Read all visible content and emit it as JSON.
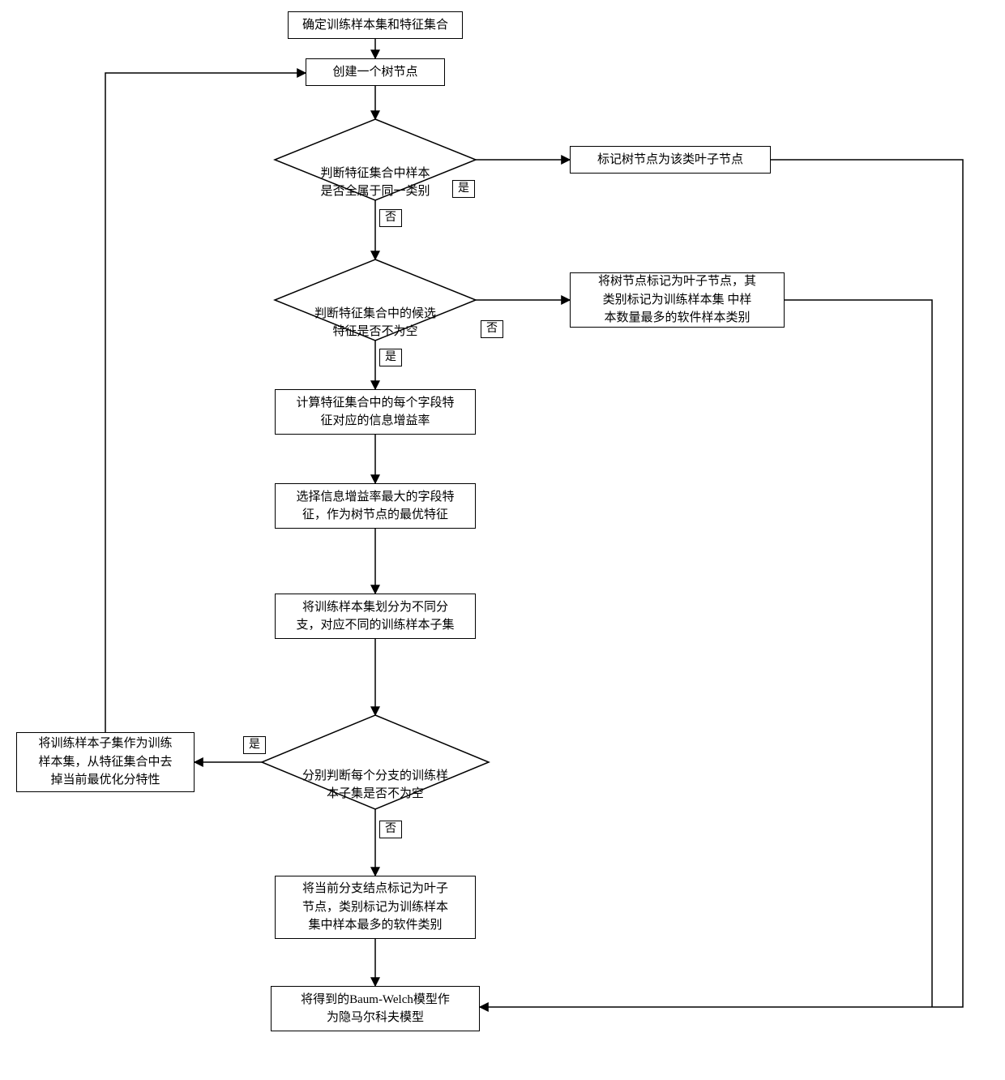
{
  "chart_data": {
    "type": "flowchart",
    "nodes": [
      {
        "id": "n1",
        "shape": "rect",
        "text": "确定训练样本集和特征集合"
      },
      {
        "id": "n2",
        "shape": "rect",
        "text": "创建一个树节点"
      },
      {
        "id": "d1",
        "shape": "diamond",
        "text": "判断特征集合中样本是否全属于同一类别"
      },
      {
        "id": "r1",
        "shape": "rect",
        "text": "标记树节点为该类叶子节点"
      },
      {
        "id": "d2",
        "shape": "diamond",
        "text": "判断特征集合中的候选特征是否不为空"
      },
      {
        "id": "r2",
        "shape": "rect",
        "text": "将树节点标记为叶子节点，其类别标记为训练样本集 中样本数量最多的软件样本类别"
      },
      {
        "id": "n3",
        "shape": "rect",
        "text": "计算特征集合中的每个字段特征对应的信息增益率"
      },
      {
        "id": "n4",
        "shape": "rect",
        "text": "选择信息增益率最大的字段特征，作为树节点的最优特征"
      },
      {
        "id": "n5",
        "shape": "rect",
        "text": "将训练样本集划分为不同分支，对应不同的训练样本子集"
      },
      {
        "id": "d3",
        "shape": "diamond",
        "text": "分别判断每个分支的训练样本子集是否不为空"
      },
      {
        "id": "l1",
        "shape": "rect",
        "text": "将训练样本子集作为训练样本集，从特征集合中去掉当前最优化分特性"
      },
      {
        "id": "n6",
        "shape": "rect",
        "text": "将当前分支结点标记为叶子节点，类别标记为训练样本集中样本最多的软件类别"
      },
      {
        "id": "n7",
        "shape": "rect",
        "text": "将得到的Baum-Welch模型作为隐马尔科夫模型"
      }
    ],
    "edges": [
      {
        "from": "n1",
        "to": "n2"
      },
      {
        "from": "n2",
        "to": "d1"
      },
      {
        "from": "d1",
        "to": "r1",
        "label": "是"
      },
      {
        "from": "d1",
        "to": "d2",
        "label": "否"
      },
      {
        "from": "d2",
        "to": "r2",
        "label": "否"
      },
      {
        "from": "d2",
        "to": "n3",
        "label": "是"
      },
      {
        "from": "n3",
        "to": "n4"
      },
      {
        "from": "n4",
        "to": "n5"
      },
      {
        "from": "n5",
        "to": "d3"
      },
      {
        "from": "d3",
        "to": "l1",
        "label": "是"
      },
      {
        "from": "d3",
        "to": "n6",
        "label": "否"
      },
      {
        "from": "l1",
        "to": "n2"
      },
      {
        "from": "n6",
        "to": "n7"
      },
      {
        "from": "r1",
        "to": "n7"
      },
      {
        "from": "r2",
        "to": "n7"
      }
    ],
    "edge_labels": {
      "yes": "是",
      "no": "否"
    }
  },
  "nodes": {
    "n1": "确定训练样本集和特征集合",
    "n2": "创建一个树节点",
    "d1": "判断特征集合中样本\n是否全属于同一类别",
    "r1": "标记树节点为该类叶子节点",
    "d2": "判断特征集合中的候选\n特征是否不为空",
    "r2": "将树节点标记为叶子节点，其\n类别标记为训练样本集 中样\n本数量最多的软件样本类别",
    "n3": "计算特征集合中的每个字段特\n征对应的信息增益率",
    "n4": "选择信息增益率最大的字段特\n征，作为树节点的最优特征",
    "n5": "将训练样本集划分为不同分\n支，对应不同的训练样本子集",
    "d3": "分别判断每个分支的训练样\n本子集是否不为空",
    "l1": "将训练样本子集作为训练\n样本集，从特征集合中去\n掉当前最优化分特性",
    "n6": "将当前分支结点标记为叶子\n节点，类别标记为训练样本\n集中样本最多的软件类别",
    "n7": "将得到的Baum-Welch模型作\n为隐马尔科夫模型"
  },
  "labels": {
    "yes": "是",
    "no": "否"
  }
}
